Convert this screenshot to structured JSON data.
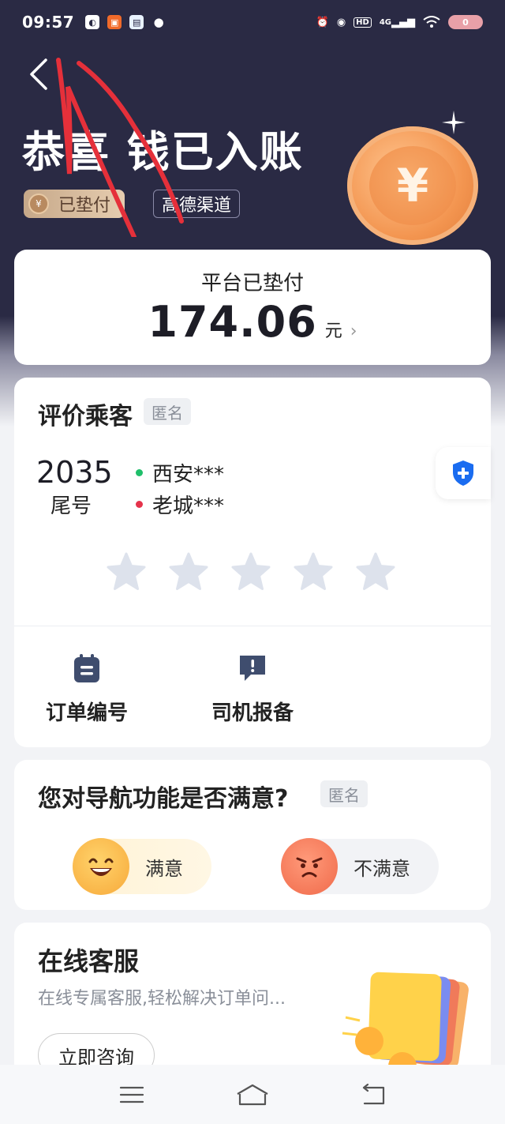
{
  "status_bar": {
    "time": "09:57",
    "network": "4G",
    "hd": "HD",
    "battery": "0"
  },
  "header": {
    "title": "恭喜 钱已入账",
    "tag_paid": "已垫付",
    "tag_channel": "高德渠道",
    "coin_symbol": "¥"
  },
  "amount_card": {
    "label": "平台已垫付",
    "value": "174.06",
    "unit": "元"
  },
  "rate_card": {
    "title": "评价乘客",
    "anonymous": "匿名",
    "tail_number": "2035",
    "tail_label": "尾号",
    "route_from": "西安***",
    "route_to": "老城***",
    "stars_selected": 0,
    "stars_total": 5,
    "actions": [
      {
        "label": "订单编号",
        "icon": "order-doc-icon"
      },
      {
        "label": "司机报备",
        "icon": "report-chat-icon"
      }
    ]
  },
  "nav_card": {
    "title": "您对导航功能是否满意?",
    "anonymous": "匿名",
    "satisfied": "满意",
    "unsatisfied": "不满意"
  },
  "cs_card": {
    "title": "在线客服",
    "subtitle": "在线专属客服,轻松解决订单问...",
    "button": "立即咨询"
  },
  "colors": {
    "header_bg": "#2a2a44",
    "accent_orange": "#f39550",
    "green_dot": "#1fbf6a",
    "red_dot": "#e5334b",
    "shield_blue": "#1a6cf0"
  }
}
